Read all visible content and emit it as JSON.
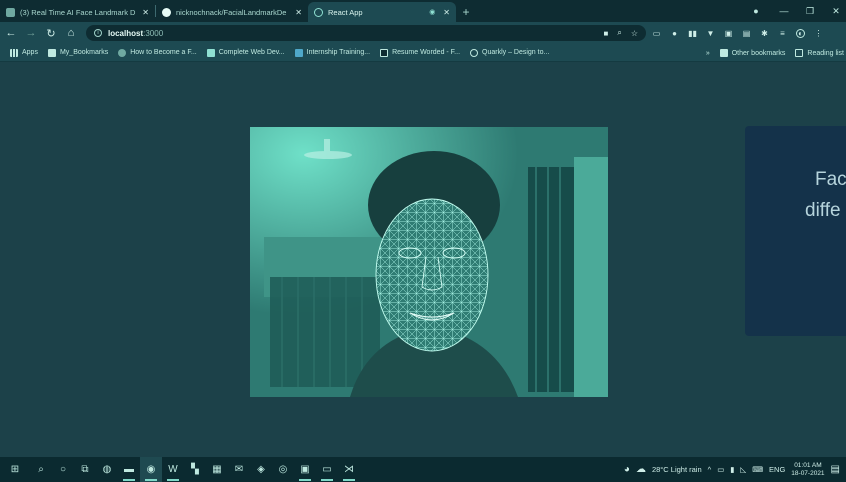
{
  "browser": {
    "tabs": [
      {
        "label": "(3) Real Time AI Face Landmark D",
        "icon": "youtube-icon"
      },
      {
        "label": "nicknochnack/FacialLandmarkDe",
        "icon": "github-icon"
      },
      {
        "label": "React App",
        "icon": "react-icon"
      }
    ],
    "address": {
      "host": "localhost",
      "port": ":3000"
    },
    "bookmarks": [
      {
        "label": "Apps",
        "icon": "apps-grid-icon"
      },
      {
        "label": "My_Bookmarks",
        "icon": "folder-icon"
      },
      {
        "label": "How to Become a F...",
        "icon": "page-icon"
      },
      {
        "label": "Complete Web Dev...",
        "icon": "doc-icon"
      },
      {
        "label": "Internship Training...",
        "icon": "s-icon"
      },
      {
        "label": "Resume Worded - F...",
        "icon": "r-icon"
      },
      {
        "label": "Quarkly – Design to...",
        "icon": "q-icon"
      }
    ],
    "bookmarks_more": "»",
    "other_bookmarks": "Other bookmarks",
    "reading_list": "Reading list"
  },
  "page": {
    "card_line1": "Fac",
    "card_line2": "diffe"
  },
  "taskbar": {
    "weather": "28°C  Light rain",
    "language": "ENG",
    "time": "01:01 AM",
    "date": "18-07-2021"
  },
  "colors": {
    "tab_bar": "#0e2c32",
    "toolbar": "#1d4a52",
    "page_bg": "#1c4149",
    "card": "#14324a",
    "mesh": "#9ff0e0"
  }
}
